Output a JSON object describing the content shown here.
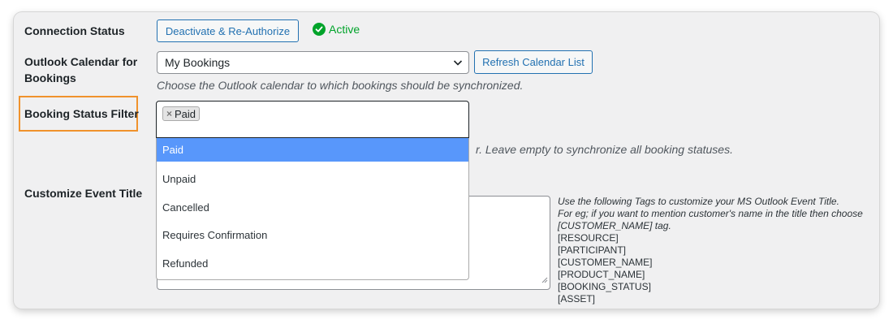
{
  "connection": {
    "label": "Connection Status",
    "deactivate_button": "Deactivate & Re-Authorize",
    "status": "Active",
    "status_color": "#00a32a"
  },
  "calendar": {
    "label_line1": "Outlook Calendar for",
    "label_line2": "Bookings",
    "selected": "My Bookings",
    "refresh_button": "Refresh Calendar List",
    "description": "Choose the Outlook calendar to which bookings should be synchronized."
  },
  "status_filter": {
    "label": "Booking Status Filter",
    "highlight_color": "#f0922c",
    "selected_tags": [
      "Paid"
    ],
    "description_visible": "r. Leave empty to synchronize all booking statuses.",
    "options": [
      {
        "label": "Paid",
        "highlighted": true
      },
      {
        "label": "Unpaid",
        "highlighted": false
      },
      {
        "label": "Cancelled",
        "highlighted": false
      },
      {
        "label": "Requires Confirmation",
        "highlighted": false
      },
      {
        "label": "Refunded",
        "highlighted": false
      }
    ]
  },
  "event_title": {
    "label": "Customize Event Title",
    "help_line1": "Use the following Tags to customize your MS Outlook Event Title.",
    "help_line2": "For eg; if you want to mention customer's name in the title then choose",
    "help_line3": "[CUSTOMER_NAME] tag.",
    "tags": [
      "[RESOURCE]",
      "[PARTICIPANT]",
      "[CUSTOMER_NAME]",
      "[PRODUCT_NAME]",
      "[BOOKING_STATUS]",
      "[ASSET]"
    ]
  }
}
